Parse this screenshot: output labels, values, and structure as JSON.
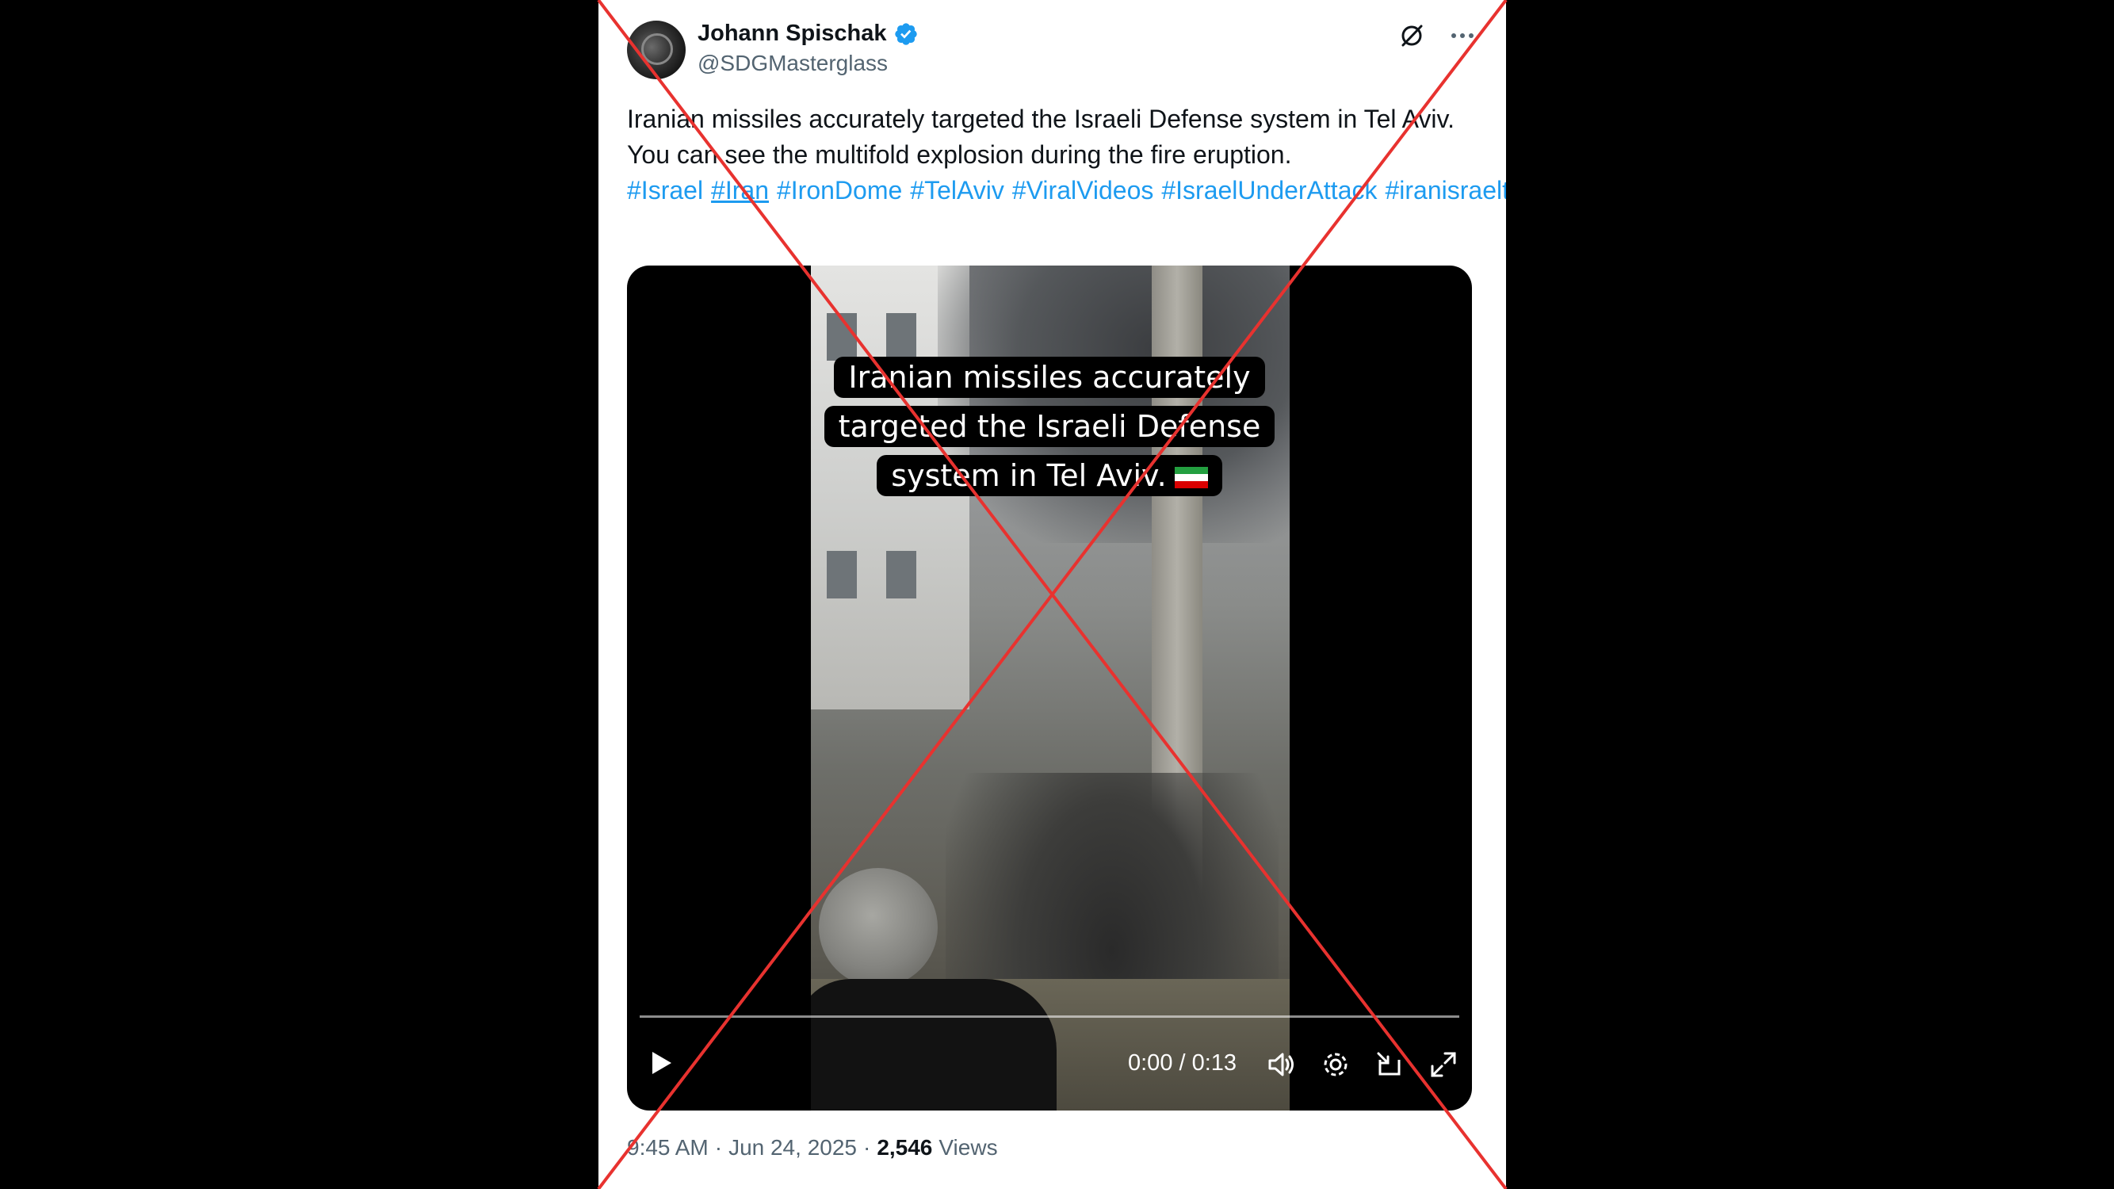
{
  "tweet": {
    "author_name": "Johann Spischak",
    "author_handle": "@SDGMasterglass",
    "verified": true,
    "text": "Iranian missiles accurately targeted the Israeli Defense system in Tel Aviv. You can see the multifold explosion during the fire eruption.",
    "hashtags": [
      "#Israel",
      "#Iran",
      "#IronDome",
      "#TelAviv",
      "#ViralVideos",
      "#IsraelUnderAttack",
      "#iranisraeltensions"
    ],
    "time": "9:45 AM",
    "separator": "·",
    "date": "Jun 24, 2025",
    "views_count": "2,546",
    "views_label": "Views"
  },
  "video": {
    "caption_lines": [
      "Iranian missiles accurately",
      "targeted the Israeli Defense",
      "system in Tel Aviv."
    ],
    "flag_icon": "iran-flag-icon",
    "time_display": "0:00 / 0:13",
    "progress_fraction": 0.0
  },
  "icons": {
    "verified": "verified-badge-icon",
    "grok": "grok-icon",
    "more": "more-options-icon",
    "play": "play-icon",
    "volume": "volume-icon",
    "settings": "settings-gear-icon",
    "minimize": "dock-icon",
    "fullscreen": "fullscreen-icon"
  },
  "colors": {
    "link": "#1d9bf0",
    "text": "#0f1419",
    "muted": "#536471",
    "background": "#000000",
    "overlay_cross": "#e8322f"
  }
}
